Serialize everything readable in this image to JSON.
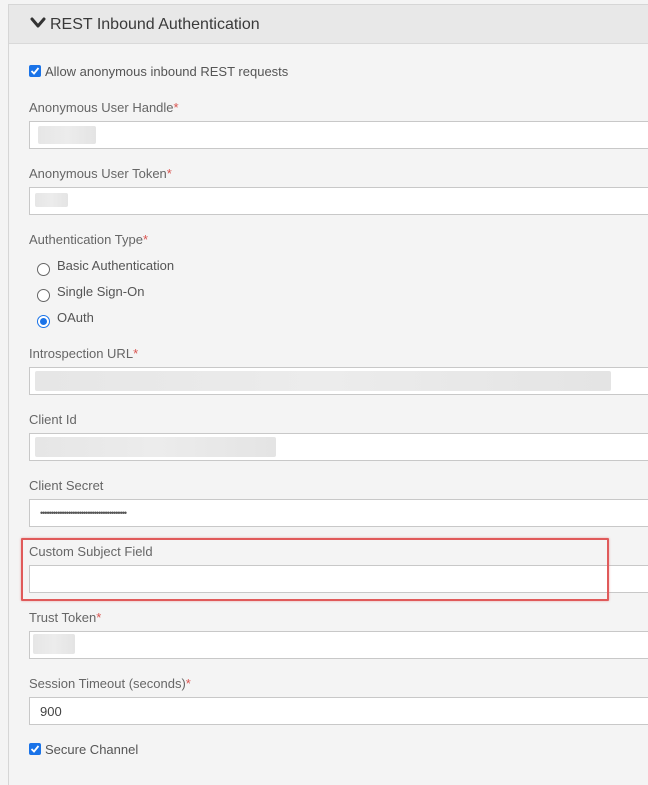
{
  "panel": {
    "title": "REST Inbound Authentication"
  },
  "allow_anonymous": {
    "label": "Allow anonymous inbound REST requests",
    "checked": true
  },
  "anonymous_user_handle": {
    "label": "Anonymous User Handle",
    "required_mark": "*",
    "value": ""
  },
  "anonymous_user_token": {
    "label": "Anonymous User Token",
    "required_mark": "*",
    "value": ""
  },
  "authentication_type": {
    "label": "Authentication Type",
    "required_mark": "*",
    "options": [
      {
        "label": "Basic Authentication",
        "selected": false
      },
      {
        "label": "Single Sign-On",
        "selected": false
      },
      {
        "label": "OAuth",
        "selected": true
      }
    ]
  },
  "introspection_url": {
    "label": "Introspection URL",
    "required_mark": "*",
    "value": ""
  },
  "client_id": {
    "label": "Client Id",
    "value": ""
  },
  "client_secret": {
    "label": "Client Secret",
    "value": "••••••••••••••••••••••••••••••••••••••••"
  },
  "custom_subject_field": {
    "label": "Custom Subject Field",
    "value": ""
  },
  "trust_token": {
    "label": "Trust Token",
    "required_mark": "*",
    "value": ""
  },
  "session_timeout": {
    "label": "Session Timeout (seconds)",
    "required_mark": "*",
    "value": "900"
  },
  "secure_channel": {
    "label": "Secure Channel",
    "checked": true
  },
  "colors": {
    "accent": "#1a73e8",
    "required": "#d9534f",
    "highlight_border": "#e05a5a"
  }
}
